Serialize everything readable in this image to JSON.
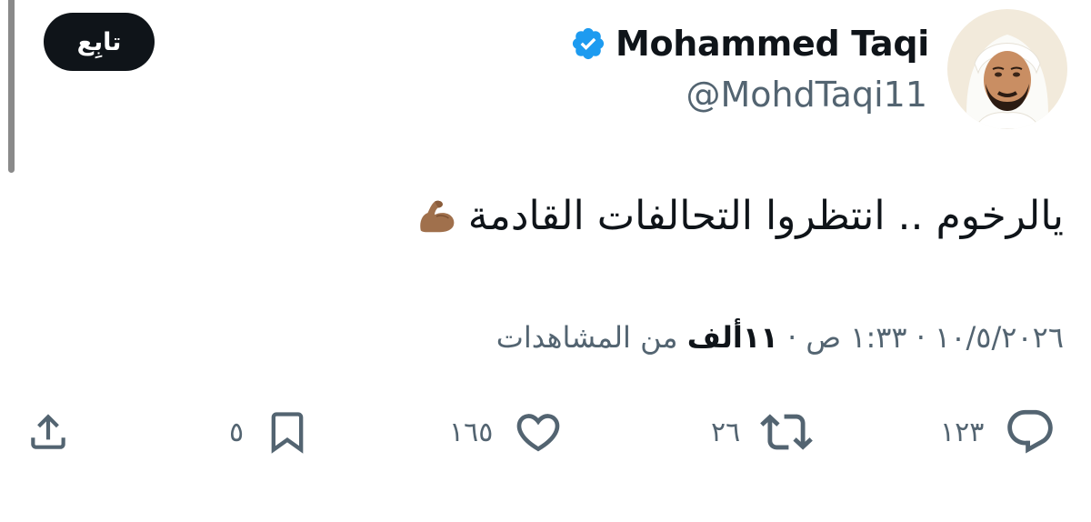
{
  "header": {
    "follow_label": "تابِع",
    "display_name": "Mohammed Taqi",
    "handle": "@MohdTaqi11"
  },
  "tweet": {
    "text": "يالرخوم .. انتظروا التحالفات القادمة",
    "emoji_icon": "flexed-biceps-icon"
  },
  "meta": {
    "date": "١٠/٥/٢٠٢٦",
    "separator": "·",
    "time": "١:٣٣ ص",
    "views_count": "١١ألف",
    "views_label": "من المشاهدات"
  },
  "actions": {
    "replies": "١٢٣",
    "retweets": "٢٦",
    "likes": "١٦٥",
    "bookmarks": "٥"
  },
  "colors": {
    "text": "#0f1419",
    "secondary": "#536471",
    "verified": "#1d9bf0",
    "follow_bg": "#0f1419"
  }
}
